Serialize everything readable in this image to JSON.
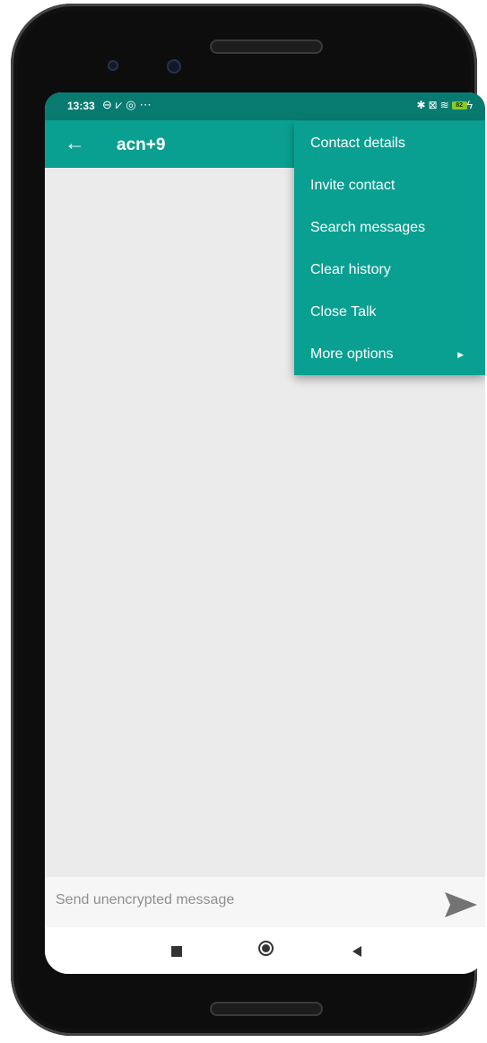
{
  "status_bar": {
    "time": "13:33",
    "left_icons": [
      "link-icon",
      "download-done-icon",
      "vpn-icon",
      "more-dots-icon"
    ],
    "right_icons": [
      "bluetooth-icon",
      "sim-icon",
      "wifi-icon",
      "battery-icon",
      "charging-icon"
    ],
    "battery_level": "82"
  },
  "app_bar": {
    "title": "acn+9",
    "back_icon": "back-arrow-icon"
  },
  "menu": {
    "items": [
      {
        "label": "Contact details"
      },
      {
        "label": "Invite contact"
      },
      {
        "label": "Search messages"
      },
      {
        "label": "Clear history"
      },
      {
        "label": "Close Talk"
      },
      {
        "label": "More options",
        "has_submenu": true
      }
    ]
  },
  "composer": {
    "placeholder": "Send unencrypted message",
    "send_icon": "send-icon"
  },
  "navigation": {
    "buttons": [
      "recents-icon",
      "home-icon",
      "back-icon"
    ]
  },
  "colors": {
    "app_bar": "#0aa091",
    "status_bar": "#087b71",
    "chat_background": "#ebebeb"
  }
}
